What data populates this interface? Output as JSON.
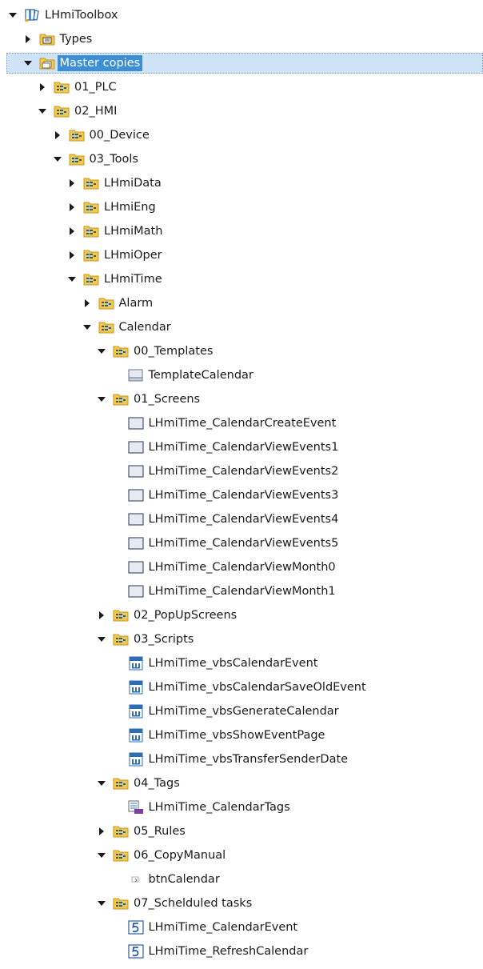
{
  "tree": {
    "nodes": [
      {
        "level": 0,
        "expander": "expanded",
        "icon": "library-icon",
        "label": "LHmiToolbox"
      },
      {
        "level": 1,
        "expander": "collapsed",
        "icon": "types-folder-icon",
        "label": "Types"
      },
      {
        "level": 1,
        "expander": "expanded",
        "icon": "master-copies-folder-icon",
        "label": "Master copies",
        "selected": true
      },
      {
        "level": 2,
        "expander": "collapsed",
        "icon": "group-folder-icon",
        "label": "01_PLC"
      },
      {
        "level": 2,
        "expander": "expanded",
        "icon": "group-folder-icon",
        "label": "02_HMI"
      },
      {
        "level": 3,
        "expander": "collapsed",
        "icon": "group-folder-icon",
        "label": "00_Device"
      },
      {
        "level": 3,
        "expander": "expanded",
        "icon": "group-folder-icon",
        "label": "03_Tools"
      },
      {
        "level": 4,
        "expander": "collapsed",
        "icon": "group-folder-icon",
        "label": "LHmiData"
      },
      {
        "level": 4,
        "expander": "collapsed",
        "icon": "group-folder-icon",
        "label": "LHmiEng"
      },
      {
        "level": 4,
        "expander": "collapsed",
        "icon": "group-folder-icon",
        "label": "LHmiMath"
      },
      {
        "level": 4,
        "expander": "collapsed",
        "icon": "group-folder-icon",
        "label": "LHmiOper"
      },
      {
        "level": 4,
        "expander": "expanded",
        "icon": "group-folder-icon",
        "label": "LHmiTime"
      },
      {
        "level": 5,
        "expander": "collapsed",
        "icon": "group-folder-icon",
        "label": "Alarm"
      },
      {
        "level": 5,
        "expander": "expanded",
        "icon": "group-folder-icon",
        "label": "Calendar"
      },
      {
        "level": 6,
        "expander": "expanded",
        "icon": "group-folder-icon",
        "label": "00_Templates"
      },
      {
        "level": 7,
        "expander": "none",
        "icon": "template-icon",
        "label": "TemplateCalendar"
      },
      {
        "level": 6,
        "expander": "expanded",
        "icon": "group-folder-icon",
        "label": "01_Screens"
      },
      {
        "level": 7,
        "expander": "none",
        "icon": "screen-icon",
        "label": "LHmiTime_CalendarCreateEvent"
      },
      {
        "level": 7,
        "expander": "none",
        "icon": "screen-icon",
        "label": "LHmiTime_CalendarViewEvents1"
      },
      {
        "level": 7,
        "expander": "none",
        "icon": "screen-icon",
        "label": "LHmiTime_CalendarViewEvents2"
      },
      {
        "level": 7,
        "expander": "none",
        "icon": "screen-icon",
        "label": "LHmiTime_CalendarViewEvents3"
      },
      {
        "level": 7,
        "expander": "none",
        "icon": "screen-icon",
        "label": "LHmiTime_CalendarViewEvents4"
      },
      {
        "level": 7,
        "expander": "none",
        "icon": "screen-icon",
        "label": "LHmiTime_CalendarViewEvents5"
      },
      {
        "level": 7,
        "expander": "none",
        "icon": "screen-icon",
        "label": "LHmiTime_CalendarViewMonth0"
      },
      {
        "level": 7,
        "expander": "none",
        "icon": "screen-icon",
        "label": "LHmiTime_CalendarViewMonth1"
      },
      {
        "level": 6,
        "expander": "collapsed",
        "icon": "group-folder-icon",
        "label": "02_PopUpScreens"
      },
      {
        "level": 6,
        "expander": "expanded",
        "icon": "group-folder-icon",
        "label": "03_Scripts"
      },
      {
        "level": 7,
        "expander": "none",
        "icon": "vbscript-icon",
        "label": "LHmiTime_vbsCalendarEvent"
      },
      {
        "level": 7,
        "expander": "none",
        "icon": "vbscript-icon",
        "label": "LHmiTime_vbsCalendarSaveOldEvent"
      },
      {
        "level": 7,
        "expander": "none",
        "icon": "vbscript-icon",
        "label": "LHmiTime_vbsGenerateCalendar"
      },
      {
        "level": 7,
        "expander": "none",
        "icon": "vbscript-icon",
        "label": "LHmiTime_vbsShowEventPage"
      },
      {
        "level": 7,
        "expander": "none",
        "icon": "vbscript-icon",
        "label": "LHmiTime_vbsTransferSenderDate"
      },
      {
        "level": 6,
        "expander": "expanded",
        "icon": "group-folder-icon",
        "label": "04_Tags"
      },
      {
        "level": 7,
        "expander": "none",
        "icon": "tag-table-icon",
        "label": "LHmiTime_CalendarTags"
      },
      {
        "level": 6,
        "expander": "collapsed",
        "icon": "group-folder-icon",
        "label": "05_Rules"
      },
      {
        "level": 6,
        "expander": "expanded",
        "icon": "group-folder-icon",
        "label": "06_CopyManual"
      },
      {
        "level": 7,
        "expander": "none",
        "icon": "button-object-icon",
        "label": "btnCalendar"
      },
      {
        "level": 6,
        "expander": "expanded",
        "icon": "group-folder-icon",
        "label": "07_Schelduled tasks"
      },
      {
        "level": 7,
        "expander": "none",
        "icon": "scheduled-task-icon",
        "label": "LHmiTime_CalendarEvent"
      },
      {
        "level": 7,
        "expander": "none",
        "icon": "scheduled-task-icon",
        "label": "LHmiTime_RefreshCalendar"
      }
    ]
  },
  "colors": {
    "selection_fill": "#3c8fd6",
    "selection_row": "#cfe3f6",
    "folder_yellow": "#f2c94c",
    "folder_border": "#c9951a",
    "group_text_blue": "#1f5fa8",
    "screen_fill": "#e6eaf2",
    "script_blue": "#2e6db4",
    "task_blue": "#2e5aa8"
  }
}
